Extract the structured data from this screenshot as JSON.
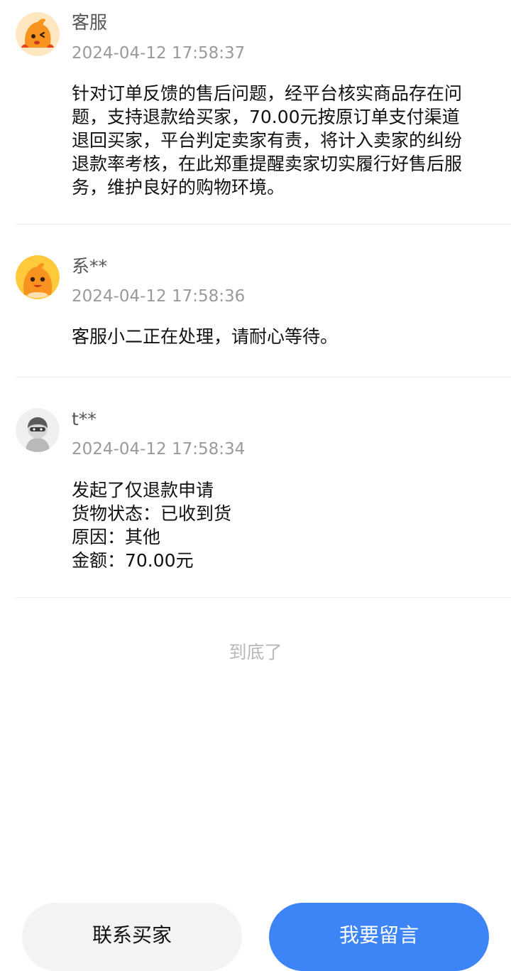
{
  "messages": [
    {
      "name": "客服",
      "time": "2024-04-12 17:58:37",
      "avatar_icon": "orange-mascot-avatar-icon",
      "lines": [
        "针对订单反馈的售后问题，经平台核实商品存在问",
        "题，支持退款给买家，70.00元按原订单支付渠道",
        "退回买家，平台判定卖家有责，将计入卖家的纠纷",
        "退款率考核，在此郑重提醒卖家切实履行好售后服",
        "务，维护良好的购物环境。"
      ]
    },
    {
      "name": "系**",
      "time": "2024-04-12 17:58:36",
      "avatar_icon": "orange-mascot-avatar-icon",
      "lines": [
        "客服小二正在处理，请耐心等待。"
      ]
    },
    {
      "name": "t**",
      "time": "2024-04-12 17:58:34",
      "avatar_icon": "default-user-avatar-icon",
      "lines": [
        "发起了仅退款申请",
        "货物状态：已收到货",
        "原因：其他",
        "金额：70.00元"
      ]
    }
  ],
  "end_text": "到底了",
  "buttons": {
    "contact_buyer": "联系买家",
    "leave_message": "我要留言"
  },
  "colors": {
    "primary_button": "#3d84f7",
    "secondary_button": "#f3f3f3",
    "timestamp": "#9a9a9a",
    "avatar_orange": "#f7931e"
  }
}
